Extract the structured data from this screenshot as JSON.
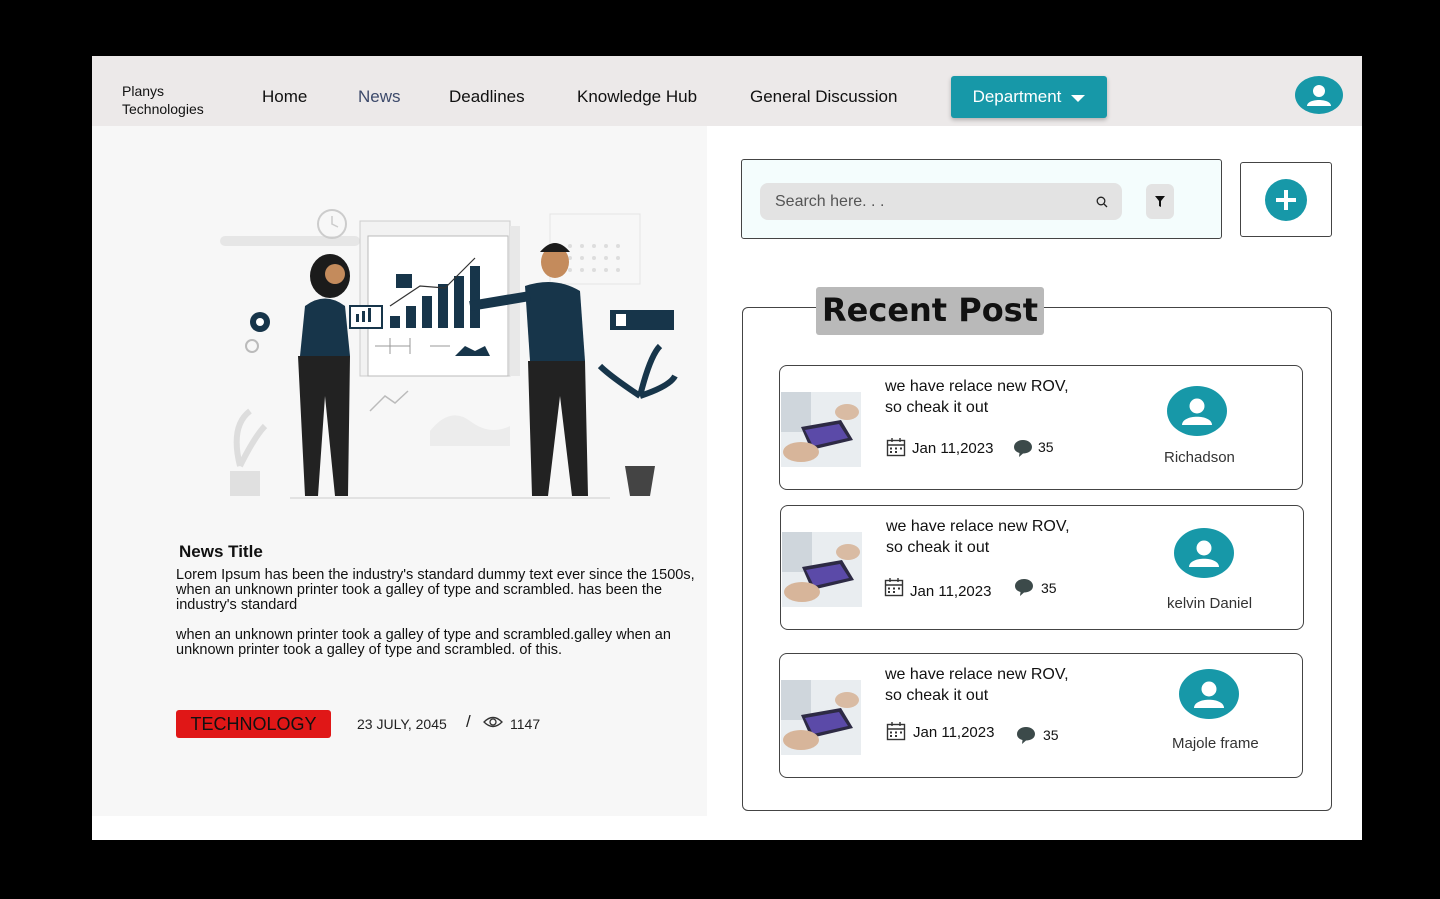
{
  "nav": {
    "brand_line1": "Planys",
    "brand_line2": "Technologies",
    "items": [
      {
        "label": "Home",
        "active": false
      },
      {
        "label": "News",
        "active": true
      },
      {
        "label": "Deadlines",
        "active": false
      },
      {
        "label": "Knowledge Hub",
        "active": false
      },
      {
        "label": "General Discussion",
        "active": false
      }
    ],
    "department_label": "Department",
    "accent_color": "#1798a8"
  },
  "news": {
    "title": "News Title",
    "paragraph1": "Lorem Ipsum has been the industry's standard dummy text ever since the 1500s, when an unknown printer took a galley of type and scrambled. has been the industry's standard",
    "paragraph2": "when an unknown printer took a galley of type and scrambled.galley when an unknown printer took a galley of type and scrambled. of this.",
    "tag": "TECHNOLOGY",
    "tag_color": "#e01717",
    "date": "23 JULY, 2045",
    "separator": "/",
    "views": "1147"
  },
  "search": {
    "placeholder": "Search here. . ."
  },
  "recent": {
    "title": "Recent Post",
    "posts": [
      {
        "line1": "we have relace new  ROV,",
        "line2": "so cheak it out",
        "date": "Jan 11,2023",
        "comments": "35",
        "author": "Richadson"
      },
      {
        "line1": "we have relace new  ROV,",
        "line2": "so cheak it out",
        "date": "Jan 11,2023",
        "comments": "35",
        "author": "kelvin Daniel"
      },
      {
        "line1": "we have relace new  ROV,",
        "line2": "so cheak it out",
        "date": "Jan 11,2023",
        "comments": "35",
        "author": "Majole frame"
      }
    ]
  }
}
